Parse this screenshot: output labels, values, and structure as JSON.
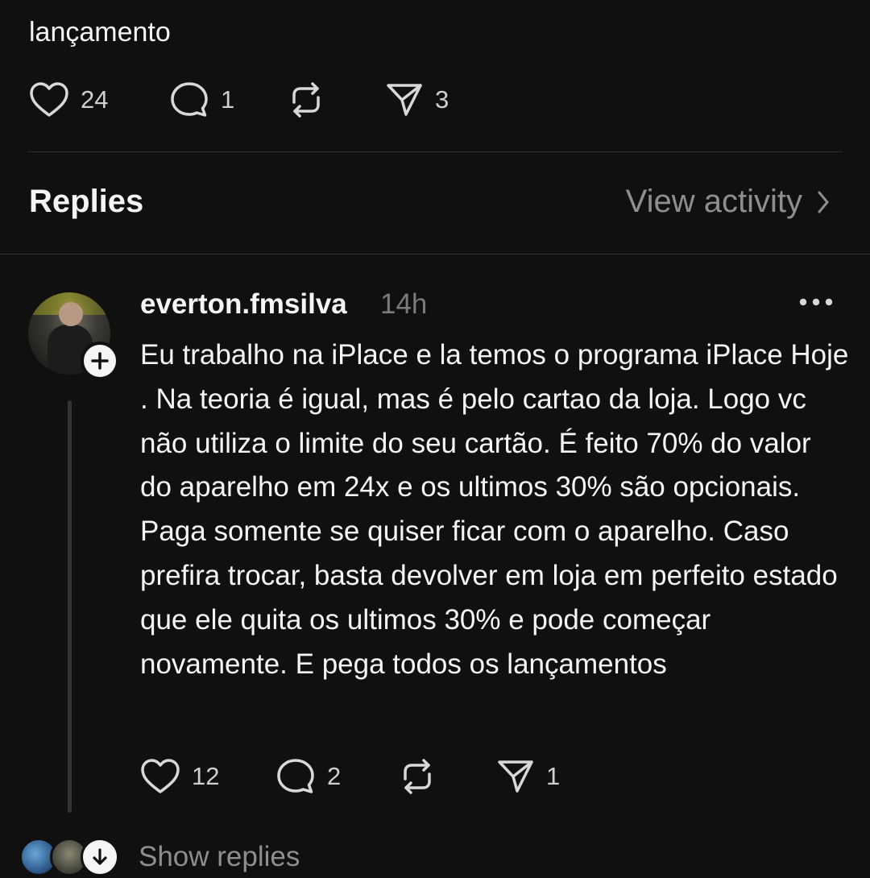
{
  "post": {
    "text_tail": "lançamento",
    "likes": "24",
    "comments": "1",
    "shares": "3"
  },
  "replies_header": {
    "title": "Replies",
    "view_activity": "View activity"
  },
  "reply": {
    "username": "everton.fmsilva",
    "time": "14h",
    "text": "Eu trabalho na iPlace e la temos o programa iPlace Hoje . Na teoria é igual, mas é pelo cartao da loja. Logo vc não utiliza o limite do seu cartão. É feito 70% do valor do aparelho em 24x e os ultimos 30% são opcionais. Paga somente se quiser ficar com o aparelho. Caso prefira trocar, basta devolver em loja em perfeito estado que ele quita os ultimos 30% e pode começar novamente. E pega todos os lançamentos",
    "likes": "12",
    "comments": "2",
    "shares": "1",
    "show_replies": "Show replies"
  },
  "icons": {
    "like": "heart-icon",
    "comment": "comment-bubble-icon",
    "repost": "repost-icon",
    "share": "send-icon",
    "more": "more-dots-icon",
    "chevron": "chevron-right-icon",
    "follow": "plus-icon",
    "expand": "arrow-down-icon"
  }
}
